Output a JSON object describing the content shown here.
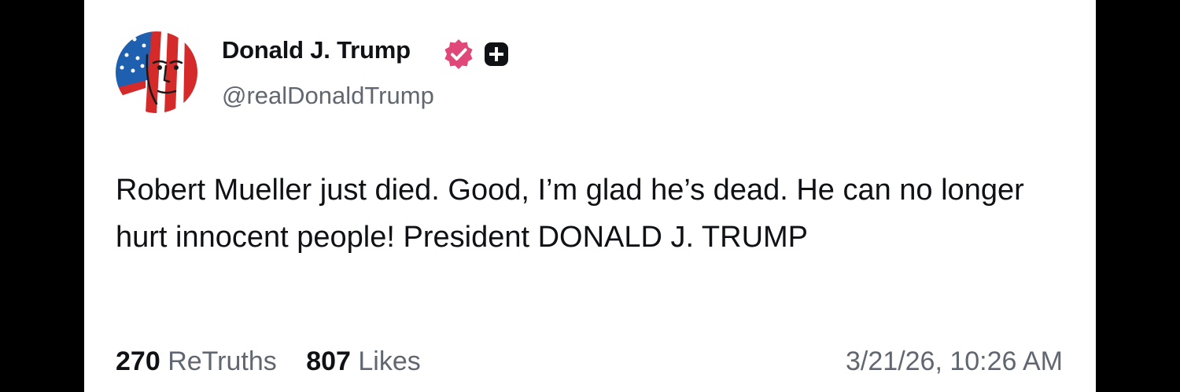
{
  "post": {
    "author": {
      "display_name": "Donald J. Trump",
      "handle": "@realDonaldTrump",
      "avatar_icon": "flag-portrait-avatar",
      "verified_icon": "verified-badge-icon",
      "plus_icon": "plus-badge-icon"
    },
    "text": "Robert Mueller just died. Good, I’m glad he’s dead. He can no longer hurt innocent people! President DONALD J. TRUMP",
    "stats": {
      "retruths_count": "270",
      "retruths_label": "ReTruths",
      "likes_count": "807",
      "likes_label": "Likes"
    },
    "timestamp": "3/21/26, 10:26 AM"
  },
  "colors": {
    "background": "#000000",
    "card": "#ffffff",
    "text": "#0f1115",
    "muted": "#606770",
    "verified": "#e0487a",
    "badge": "#0f1115"
  }
}
